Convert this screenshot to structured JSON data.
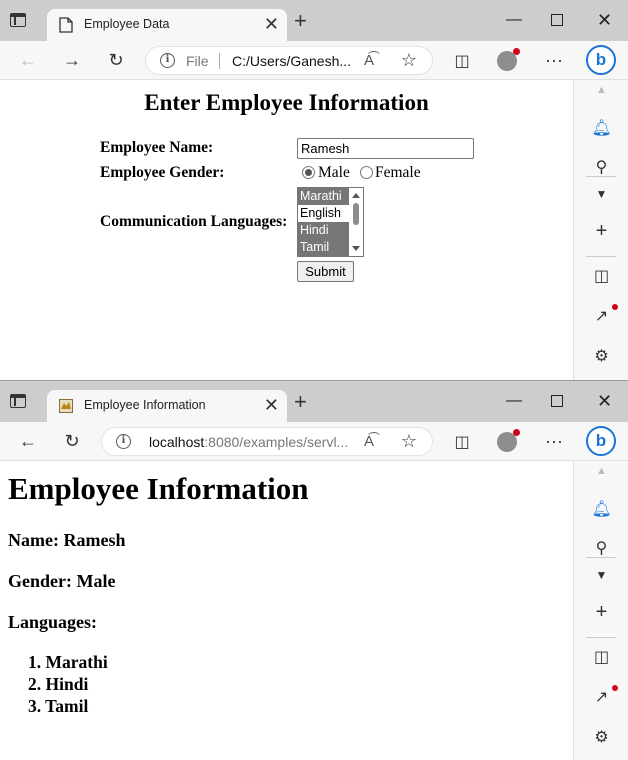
{
  "window1": {
    "tab_title": "Employee Data",
    "address": {
      "scheme_label": "File",
      "path": "C:/Users/Ganesh..."
    },
    "form": {
      "heading": "Enter Employee Information",
      "name_label": "Employee Name:",
      "name_value": "Ramesh",
      "gender_label": "Employee Gender:",
      "gender_options": [
        "Male",
        "Female"
      ],
      "gender_selected": "Male",
      "languages_label": "Communication Languages:",
      "language_options": [
        {
          "label": "Marathi",
          "selected": true
        },
        {
          "label": "English",
          "selected": false
        },
        {
          "label": "Hindi",
          "selected": true
        },
        {
          "label": "Tamil",
          "selected": true
        }
      ],
      "submit_label": "Submit"
    }
  },
  "window2": {
    "tab_title": "Employee Information",
    "address": {
      "host": "localhost",
      "rest": ":8080/examples/servl..."
    },
    "output": {
      "heading": "Employee Information",
      "name_line": "Name: Ramesh",
      "gender_line": "Gender: Male",
      "languages_label": "Languages:",
      "languages": [
        "1. Marathi",
        "2. Hindi",
        "3. Tamil"
      ]
    }
  },
  "icons": {
    "tab_actions": "tab-actions-icon",
    "page": "page-icon",
    "favicon": "tomcat-favicon",
    "new_tab": "plus-icon",
    "back": "arrow-left-icon",
    "forward": "arrow-right-icon",
    "refresh": "refresh-icon",
    "info": "info-icon",
    "read_aloud": "read-aloud-icon",
    "favorite": "star-icon",
    "split_screen": "split-screen-icon",
    "profile": "profile-avatar-icon",
    "more": "more-icon",
    "copilot": "bing-copilot-icon"
  },
  "colors": {
    "titlebar": "#cdcdcd",
    "toolbar": "#f7f7f7",
    "accent_blue": "#1b74d6",
    "selected_option": "#767676",
    "notification_dot": "#d0021b"
  }
}
